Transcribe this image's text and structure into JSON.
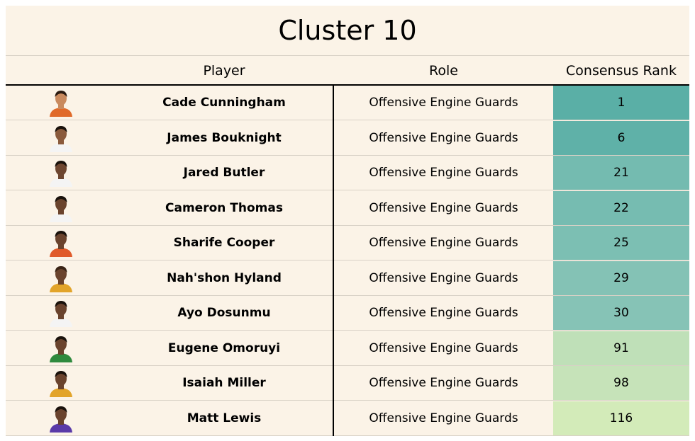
{
  "title": "Cluster 10",
  "columns": [
    "Player",
    "Role",
    "Consensus Rank"
  ],
  "rows": [
    {
      "player": "Cade Cunningham",
      "role": "Offensive Engine Guards",
      "rank": "1",
      "rank_color": "#5aafa6",
      "jersey": "#e06a2a",
      "skin": "#c98a5e",
      "hair": "#2a1a10"
    },
    {
      "player": "James Bouknight",
      "role": "Offensive Engine Guards",
      "rank": "6",
      "rank_color": "#5fb1a8",
      "jersey": "#f4f4f4",
      "skin": "#8a5a3c",
      "hair": "#1a120c"
    },
    {
      "player": "Jared Butler",
      "role": "Offensive Engine Guards",
      "rank": "21",
      "rank_color": "#74bbb0",
      "jersey": "#f4f4f4",
      "skin": "#6e4630",
      "hair": "#1a120c"
    },
    {
      "player": "Cameron Thomas",
      "role": "Offensive Engine Guards",
      "rank": "22",
      "rank_color": "#76bcb1",
      "jersey": "#f4f4f4",
      "skin": "#6a432d",
      "hair": "#1a120c"
    },
    {
      "player": "Sharife Cooper",
      "role": "Offensive Engine Guards",
      "rank": "25",
      "rank_color": "#7cbfb3",
      "jersey": "#e05a2a",
      "skin": "#6a432d",
      "hair": "#1a120c"
    },
    {
      "player": "Nah'shon Hyland",
      "role": "Offensive Engine Guards",
      "rank": "29",
      "rank_color": "#84c2b5",
      "jersey": "#e2a42a",
      "skin": "#6a432d",
      "hair": "#3a2416"
    },
    {
      "player": "Ayo Dosunmu",
      "role": "Offensive Engine Guards",
      "rank": "30",
      "rank_color": "#86c3b6",
      "jersey": "#f4f4f4",
      "skin": "#6a432d",
      "hair": "#1a120c"
    },
    {
      "player": "Eugene Omoruyi",
      "role": "Offensive Engine Guards",
      "rank": "91",
      "rank_color": "#bfe0b8",
      "jersey": "#2f8a3e",
      "skin": "#6a432d",
      "hair": "#1a120c"
    },
    {
      "player": "Isaiah Miller",
      "role": "Offensive Engine Guards",
      "rank": "98",
      "rank_color": "#c6e3b9",
      "jersey": "#e2a42a",
      "skin": "#6a432d",
      "hair": "#1a120c"
    },
    {
      "player": "Matt Lewis",
      "role": "Offensive Engine Guards",
      "rank": "116",
      "rank_color": "#d3ebb9",
      "jersey": "#5a3aa8",
      "skin": "#6a432d",
      "hair": "#1a120c"
    }
  ],
  "chart_data": {
    "type": "table",
    "title": "Cluster 10",
    "columns": [
      "Player",
      "Role",
      "Consensus Rank"
    ],
    "values": [
      [
        "Cade Cunningham",
        "Offensive Engine Guards",
        1
      ],
      [
        "James Bouknight",
        "Offensive Engine Guards",
        6
      ],
      [
        "Jared Butler",
        "Offensive Engine Guards",
        21
      ],
      [
        "Cameron Thomas",
        "Offensive Engine Guards",
        22
      ],
      [
        "Sharife Cooper",
        "Offensive Engine Guards",
        25
      ],
      [
        "Nah'shon Hyland",
        "Offensive Engine Guards",
        29
      ],
      [
        "Ayo Dosunmu",
        "Offensive Engine Guards",
        30
      ],
      [
        "Eugene Omoruyi",
        "Offensive Engine Guards",
        91
      ],
      [
        "Isaiah Miller",
        "Offensive Engine Guards",
        98
      ],
      [
        "Matt Lewis",
        "Offensive Engine Guards",
        116
      ]
    ]
  }
}
